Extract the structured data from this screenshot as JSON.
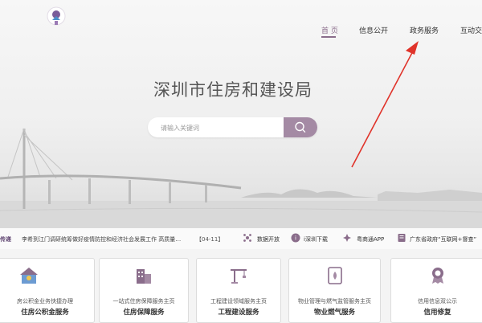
{
  "nav": {
    "home": "首 页",
    "info_open": "信息公开",
    "gov_services": "政务服务",
    "interaction": "互动交流"
  },
  "title": "深圳市住房和建设局",
  "search": {
    "placeholder": "请输入关键词"
  },
  "ticker": {
    "label": "传递",
    "headline": "李希到江门调研统筹做好疫情防控和经济社会发展工作 高质量…",
    "date": "【04-11】",
    "links": [
      "数据开放",
      "i深圳下载",
      "粤商通APP",
      "广东省政府“互联网+督查”"
    ]
  },
  "cards": [
    {
      "sub": "房公积金业务快捷办理",
      "main": "住房公积金服务",
      "icon": "house-fund-icon"
    },
    {
      "sub": "一站式住房保障服务主页",
      "main": "住房保障服务",
      "icon": "building-icon"
    },
    {
      "sub": "工程建设领域服务主页",
      "main": "工程建设服务",
      "icon": "crane-icon"
    },
    {
      "sub": "物业管理与燃气监管服务主页",
      "main": "物业燃气服务",
      "icon": "gas-icon"
    },
    {
      "sub": "信用信息双公示",
      "main": "信用修复",
      "icon": "credit-badge-icon"
    }
  ],
  "colors": {
    "accent": "#a48aa4",
    "active_nav": "#8a6d8b",
    "arrow": "#e0332a"
  }
}
